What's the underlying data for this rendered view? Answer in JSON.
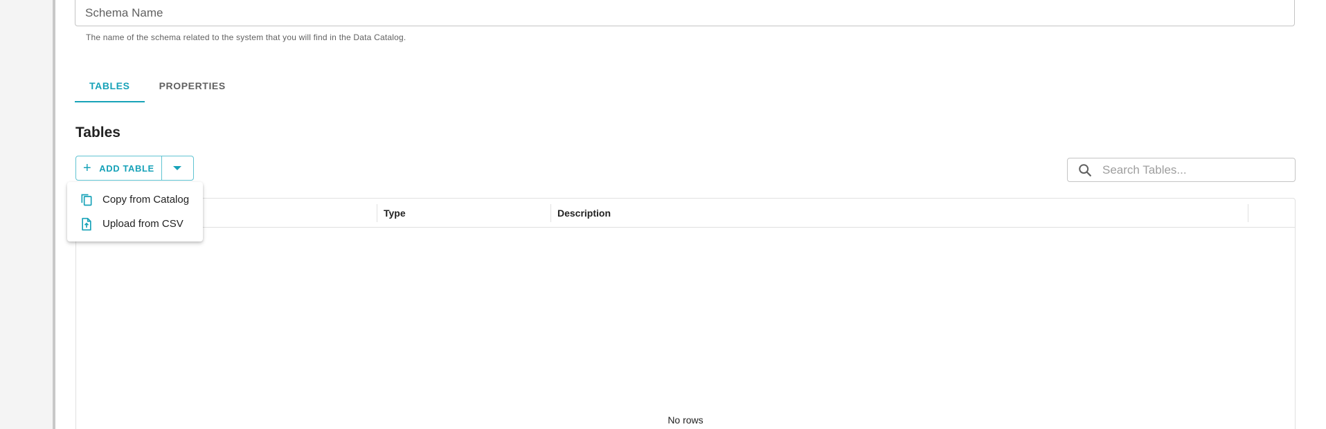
{
  "schema": {
    "placeholder": "Schema Name",
    "value": "",
    "helper_text": "The name of the schema related to the system that you will find in the Data Catalog."
  },
  "tabs": [
    {
      "label": "TABLES",
      "active": true
    },
    {
      "label": "PROPERTIES",
      "active": false
    }
  ],
  "section_title": "Tables",
  "toolbar": {
    "add_table_label": "ADD TABLE",
    "add_icon": "plus-icon",
    "dropdown_icon": "caret-down-icon"
  },
  "search": {
    "placeholder": "Search Tables...",
    "icon": "search-icon"
  },
  "grid": {
    "columns": [
      "",
      "Type",
      "Description",
      ""
    ],
    "empty_text": "No rows"
  },
  "menu": {
    "items": [
      {
        "label": "Copy from Catalog",
        "icon": "copy-icon"
      },
      {
        "label": "Upload from CSV",
        "icon": "upload-file-icon"
      }
    ]
  },
  "colors": {
    "accent": "#17a2b8",
    "text": "#212121",
    "muted": "#616161",
    "border": "#e0e0e0"
  }
}
